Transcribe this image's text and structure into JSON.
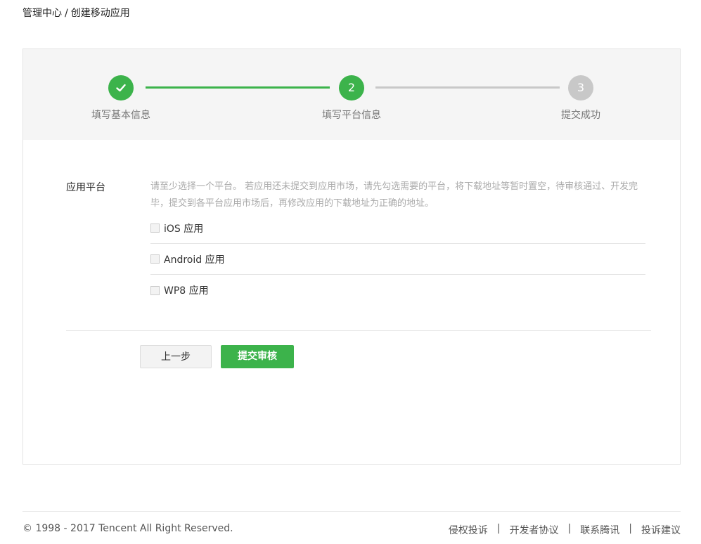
{
  "breadcrumb": {
    "root": "管理中心",
    "separator": "/",
    "current": "创建移动应用"
  },
  "steps": [
    {
      "label": "填写基本信息",
      "state": "done",
      "icon": "check-icon"
    },
    {
      "label": "填写平台信息",
      "state": "active",
      "number": "2"
    },
    {
      "label": "提交成功",
      "state": "todo",
      "number": "3"
    }
  ],
  "form": {
    "platform_label": "应用平台",
    "hint": "请至少选择一个平台。 若应用还未提交到应用市场，请先勾选需要的平台，将下载地址等暂时置空，待审核通过、开发完毕，提交到各平台应用市场后，再修改应用的下载地址为正确的地址。",
    "options": [
      {
        "label": "iOS 应用",
        "checked": false
      },
      {
        "label": "Android 应用",
        "checked": false
      },
      {
        "label": "WP8 应用",
        "checked": false
      }
    ],
    "prev_button": "上一步",
    "submit_button": "提交审核"
  },
  "footer": {
    "copyright": "© 1998 - 2017 Tencent All Right Reserved.",
    "links": [
      "侵权投诉",
      "开发者协议",
      "联系腾讯",
      "投诉建议"
    ],
    "separator": "|"
  },
  "colors": {
    "accent": "#3cb34b",
    "inactive": "#c8c8c8",
    "step_bg": "#f5f5f5"
  }
}
